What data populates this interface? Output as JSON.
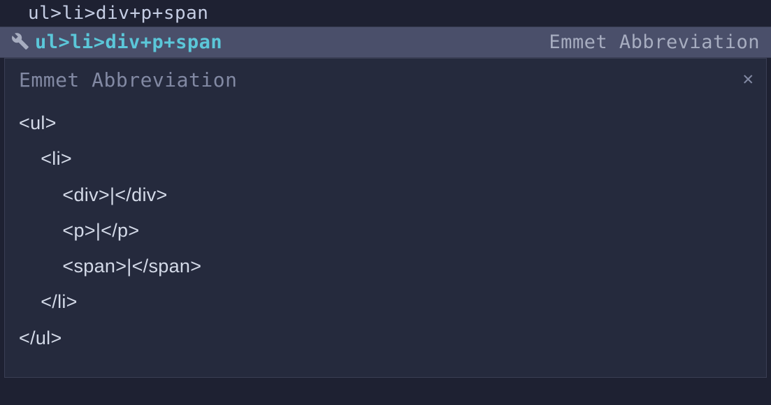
{
  "editor": {
    "input_text": "ul>li>div+p+span"
  },
  "suggestion": {
    "abbreviation": "ul>li>div+p+span",
    "type_label": "Emmet Abbreviation"
  },
  "preview": {
    "title": "Emmet Abbreviation",
    "lines": [
      "<ul>",
      "    <li>",
      "        <div>|</div>",
      "        <p>|</p>",
      "        <span>|</span>",
      "    </li>",
      "</ul>"
    ]
  }
}
